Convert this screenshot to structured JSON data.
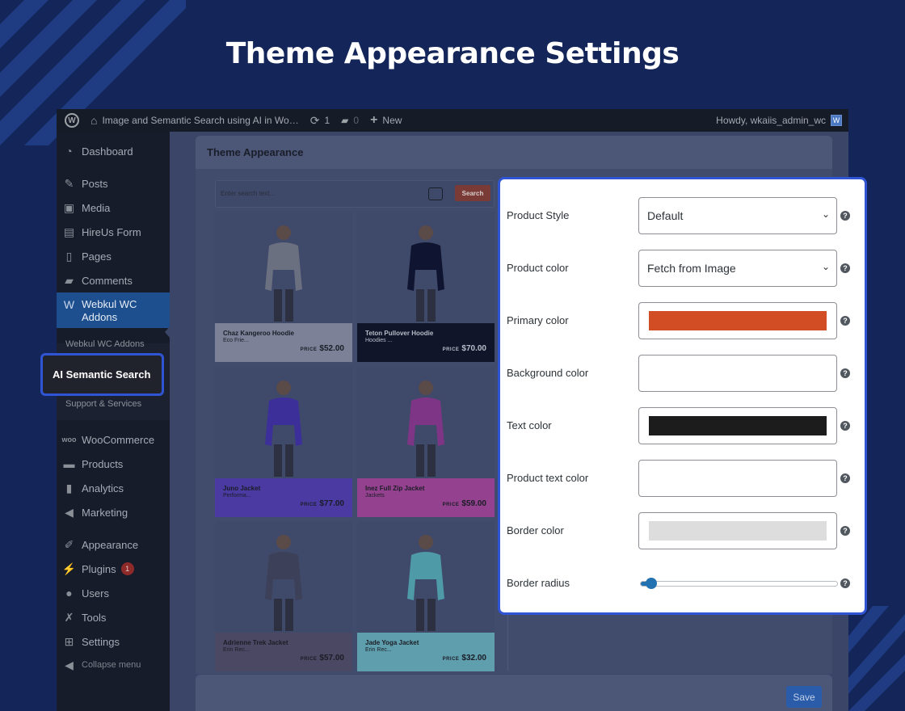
{
  "hero": {
    "title": "Theme Appearance Settings"
  },
  "admin_bar": {
    "site_name": "Image and Semantic Search using AI in Wo…",
    "updates_count": "1",
    "comments_count": "0",
    "new_label": "New",
    "howdy": "Howdy, wkaiis_admin_wc"
  },
  "sidebar": {
    "items": [
      {
        "label": "Dashboard",
        "icon": "dashboard-icon"
      },
      {
        "label": "Posts",
        "icon": "pin-icon"
      },
      {
        "label": "Media",
        "icon": "media-icon"
      },
      {
        "label": "HireUs Form",
        "icon": "form-icon"
      },
      {
        "label": "Pages",
        "icon": "pages-icon"
      },
      {
        "label": "Comments",
        "icon": "comment-icon"
      },
      {
        "label": "Webkul WC Addons",
        "icon": "webkul-icon"
      },
      {
        "label": "WooCommerce",
        "icon": "woo-icon"
      },
      {
        "label": "Products",
        "icon": "archive-icon"
      },
      {
        "label": "Analytics",
        "icon": "bar-chart-icon"
      },
      {
        "label": "Marketing",
        "icon": "megaphone-icon"
      },
      {
        "label": "Appearance",
        "icon": "brush-icon"
      },
      {
        "label": "Plugins",
        "icon": "plug-icon",
        "badge": "1"
      },
      {
        "label": "Users",
        "icon": "user-icon"
      },
      {
        "label": "Tools",
        "icon": "wrench-icon"
      },
      {
        "label": "Settings",
        "icon": "settings-icon"
      },
      {
        "label": "Collapse menu",
        "icon": "collapse-icon"
      }
    ],
    "submenu": [
      "Webkul WC Addons",
      "AI Semantic Search",
      "Support & Services"
    ]
  },
  "page": {
    "section_title": "Theme Appearance",
    "save_label": "Save"
  },
  "preview": {
    "search_placeholder": "Enter search text...",
    "search_button": "Search",
    "price_label": "PRICE",
    "products": [
      {
        "name": "Chaz Kangeroo Hoodie",
        "category": "Eco Frie...",
        "price": "$52.00",
        "color": "#7c8197",
        "shirt": "#6a7080",
        "dark": false
      },
      {
        "name": "Teton Pullover Hoodie",
        "category": "Hoodies ...",
        "price": "$70.00",
        "color": "#11152a",
        "shirt": "#0f1530",
        "dark": true
      },
      {
        "name": "Juno Jacket",
        "category": "Performa...",
        "price": "$77.00",
        "color": "#4a3aa2",
        "shirt": "#3d2f9a",
        "dark": false
      },
      {
        "name": "Inez Full Zip Jacket",
        "category": "Jackets",
        "price": "$59.00",
        "color": "#94418f",
        "shirt": "#7f3585",
        "dark": false
      },
      {
        "name": "Adrienne Trek Jacket",
        "category": "Erin Rec...",
        "price": "$57.00",
        "color": "#4a4862",
        "shirt": "#3c4059",
        "dark": false
      },
      {
        "name": "Jade Yoga Jacket",
        "category": "Erin Rec...",
        "price": "$32.00",
        "color": "#5f9eac",
        "shirt": "#4e9aa6",
        "dark": false
      }
    ]
  },
  "settings": {
    "rows": [
      {
        "label": "Product Style",
        "type": "select",
        "value": "Default"
      },
      {
        "label": "Product color",
        "type": "select",
        "value": "Fetch from Image"
      },
      {
        "label": "Primary color",
        "type": "color",
        "value": "#d24d23"
      },
      {
        "label": "Background color",
        "type": "color",
        "value": "#ffffff"
      },
      {
        "label": "Text color",
        "type": "color",
        "value": "#1c1c1c"
      },
      {
        "label": "Product text color",
        "type": "color",
        "value": "#ffffff"
      },
      {
        "label": "Border color",
        "type": "color",
        "value": "#dddddd"
      },
      {
        "label": "Border radius",
        "type": "range",
        "value": 0.06
      }
    ],
    "help_glyph": "?"
  },
  "colors": {
    "background": "#132559",
    "highlight_border": "#2f55d4",
    "wp_admin_active": "#1d4f8f"
  }
}
